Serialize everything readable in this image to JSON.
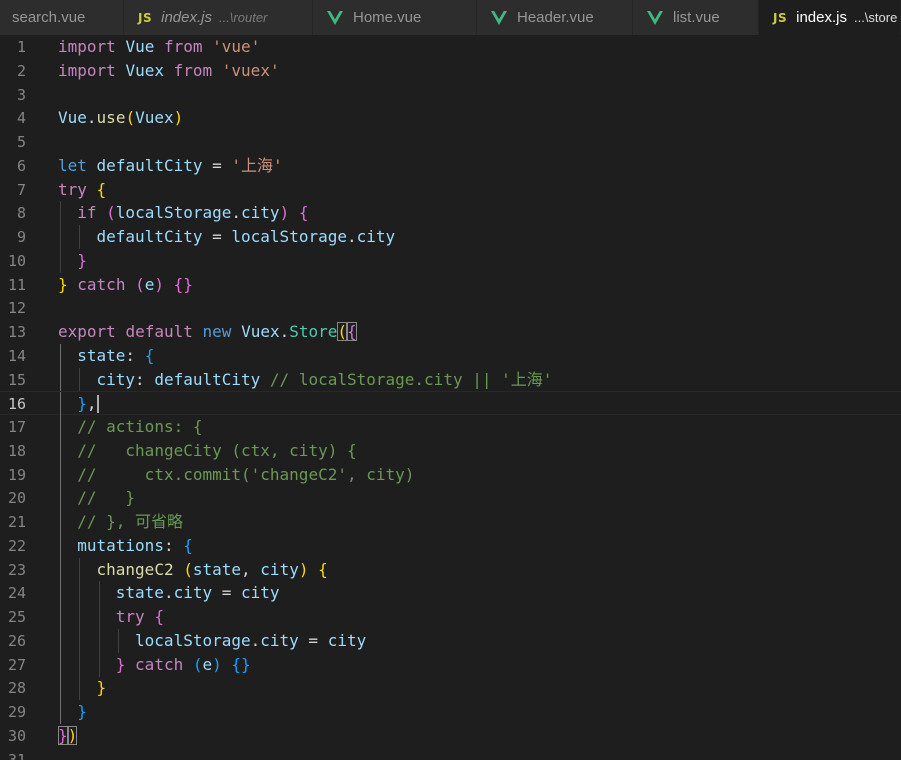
{
  "tabs": [
    {
      "icon": "",
      "name": "search.vue",
      "desc": "",
      "italic": false,
      "active": false
    },
    {
      "icon": "js",
      "name": "index.js",
      "desc": "...\\router",
      "italic": true,
      "active": false
    },
    {
      "icon": "vue",
      "name": "Home.vue",
      "desc": "",
      "italic": false,
      "active": false
    },
    {
      "icon": "vue",
      "name": "Header.vue",
      "desc": "",
      "italic": false,
      "active": false
    },
    {
      "icon": "vue",
      "name": "list.vue",
      "desc": "",
      "italic": false,
      "active": false
    },
    {
      "icon": "js",
      "name": "index.js",
      "desc": "...\\store",
      "italic": false,
      "active": true
    }
  ],
  "js_icon_label": "JS",
  "colors": {
    "vue_icon": "#41b883",
    "js_icon": "#cbcb41",
    "editor_bg": "#1e1e1e"
  },
  "editor": {
    "current_line": 16,
    "lines": [
      {
        "n": "1",
        "indent": 0,
        "tokens": [
          [
            "kw",
            "import"
          ],
          [
            "p",
            " "
          ],
          [
            "id",
            "Vue"
          ],
          [
            "p",
            " "
          ],
          [
            "kw",
            "from"
          ],
          [
            "p",
            " "
          ],
          [
            "str",
            "'vue'"
          ]
        ]
      },
      {
        "n": "2",
        "indent": 0,
        "tokens": [
          [
            "kw",
            "import"
          ],
          [
            "p",
            " "
          ],
          [
            "id",
            "Vuex"
          ],
          [
            "p",
            " "
          ],
          [
            "kw",
            "from"
          ],
          [
            "p",
            " "
          ],
          [
            "str",
            "'vuex'"
          ]
        ]
      },
      {
        "n": "3",
        "indent": 0,
        "tokens": []
      },
      {
        "n": "4",
        "indent": 0,
        "tokens": [
          [
            "id",
            "Vue"
          ],
          [
            "p",
            "."
          ],
          [
            "fn",
            "use"
          ],
          [
            "b1",
            "("
          ],
          [
            "id",
            "Vuex"
          ],
          [
            "b1",
            ")"
          ]
        ]
      },
      {
        "n": "5",
        "indent": 0,
        "tokens": []
      },
      {
        "n": "6",
        "indent": 0,
        "tokens": [
          [
            "kwb",
            "let"
          ],
          [
            "p",
            " "
          ],
          [
            "id",
            "defaultCity"
          ],
          [
            "p",
            " = "
          ],
          [
            "str",
            "'上海'"
          ]
        ]
      },
      {
        "n": "7",
        "indent": 0,
        "tokens": [
          [
            "kw",
            "try"
          ],
          [
            "p",
            " "
          ],
          [
            "b1",
            "{"
          ]
        ]
      },
      {
        "n": "8",
        "indent": 1,
        "tokens": [
          [
            "kw",
            "if"
          ],
          [
            "p",
            " "
          ],
          [
            "b2",
            "("
          ],
          [
            "id",
            "localStorage"
          ],
          [
            "p",
            "."
          ],
          [
            "id",
            "city"
          ],
          [
            "b2",
            ")"
          ],
          [
            "p",
            " "
          ],
          [
            "b2",
            "{"
          ]
        ]
      },
      {
        "n": "9",
        "indent": 2,
        "tokens": [
          [
            "id",
            "defaultCity"
          ],
          [
            "p",
            " = "
          ],
          [
            "id",
            "localStorage"
          ],
          [
            "p",
            "."
          ],
          [
            "id",
            "city"
          ]
        ]
      },
      {
        "n": "10",
        "indent": 1,
        "tokens": [
          [
            "b2",
            "}"
          ]
        ]
      },
      {
        "n": "11",
        "indent": 0,
        "tokens": [
          [
            "b1",
            "}"
          ],
          [
            "p",
            " "
          ],
          [
            "kw",
            "catch"
          ],
          [
            "p",
            " "
          ],
          [
            "b2",
            "("
          ],
          [
            "id",
            "e"
          ],
          [
            "b2",
            ")"
          ],
          [
            "p",
            " "
          ],
          [
            "b2",
            "{}"
          ]
        ]
      },
      {
        "n": "12",
        "indent": 0,
        "tokens": []
      },
      {
        "n": "13",
        "indent": 0,
        "tokens": [
          [
            "kw",
            "export"
          ],
          [
            "p",
            " "
          ],
          [
            "kw",
            "default"
          ],
          [
            "p",
            " "
          ],
          [
            "kwb",
            "new"
          ],
          [
            "p",
            " "
          ],
          [
            "id",
            "Vuex"
          ],
          [
            "p",
            "."
          ],
          [
            "cls",
            "Store"
          ],
          [
            "b1",
            "("
          ],
          [
            "b2",
            "{"
          ]
        ]
      },
      {
        "n": "14",
        "indent": 1,
        "tokens": [
          [
            "id",
            "state"
          ],
          [
            "p",
            ": "
          ],
          [
            "b3",
            "{"
          ]
        ]
      },
      {
        "n": "15",
        "indent": 2,
        "tokens": [
          [
            "id",
            "city"
          ],
          [
            "p",
            ": "
          ],
          [
            "id",
            "defaultCity"
          ],
          [
            "p",
            " "
          ],
          [
            "com",
            "// localStorage.city || '上海'"
          ]
        ]
      },
      {
        "n": "16",
        "indent": 1,
        "tokens": [
          [
            "b3",
            "}"
          ],
          [
            "p",
            ","
          ]
        ]
      },
      {
        "n": "17",
        "indent": 1,
        "tokens": [
          [
            "com",
            "// actions: {"
          ]
        ]
      },
      {
        "n": "18",
        "indent": 1,
        "tokens": [
          [
            "com",
            "//   changeCity (ctx, city) {"
          ]
        ]
      },
      {
        "n": "19",
        "indent": 1,
        "tokens": [
          [
            "com",
            "//     ctx.commit('changeC2', city)"
          ]
        ]
      },
      {
        "n": "20",
        "indent": 1,
        "tokens": [
          [
            "com",
            "//   }"
          ]
        ]
      },
      {
        "n": "21",
        "indent": 1,
        "tokens": [
          [
            "com",
            "// }, 可省略"
          ]
        ]
      },
      {
        "n": "22",
        "indent": 1,
        "tokens": [
          [
            "id",
            "mutations"
          ],
          [
            "p",
            ": "
          ],
          [
            "b3",
            "{"
          ]
        ]
      },
      {
        "n": "23",
        "indent": 2,
        "tokens": [
          [
            "fn",
            "changeC2"
          ],
          [
            "p",
            " "
          ],
          [
            "b1",
            "("
          ],
          [
            "id",
            "state"
          ],
          [
            "p",
            ", "
          ],
          [
            "id",
            "city"
          ],
          [
            "b1",
            ")"
          ],
          [
            "p",
            " "
          ],
          [
            "b1",
            "{"
          ]
        ]
      },
      {
        "n": "24",
        "indent": 3,
        "tokens": [
          [
            "id",
            "state"
          ],
          [
            "p",
            "."
          ],
          [
            "id",
            "city"
          ],
          [
            "p",
            " = "
          ],
          [
            "id",
            "city"
          ]
        ]
      },
      {
        "n": "25",
        "indent": 3,
        "tokens": [
          [
            "kw",
            "try"
          ],
          [
            "p",
            " "
          ],
          [
            "b2",
            "{"
          ]
        ]
      },
      {
        "n": "26",
        "indent": 4,
        "tokens": [
          [
            "id",
            "localStorage"
          ],
          [
            "p",
            "."
          ],
          [
            "id",
            "city"
          ],
          [
            "p",
            " = "
          ],
          [
            "id",
            "city"
          ]
        ]
      },
      {
        "n": "27",
        "indent": 3,
        "tokens": [
          [
            "b2",
            "}"
          ],
          [
            "p",
            " "
          ],
          [
            "kw",
            "catch"
          ],
          [
            "p",
            " "
          ],
          [
            "b3",
            "("
          ],
          [
            "id",
            "e"
          ],
          [
            "b3",
            ")"
          ],
          [
            "p",
            " "
          ],
          [
            "b3",
            "{}"
          ]
        ]
      },
      {
        "n": "28",
        "indent": 2,
        "tokens": [
          [
            "b1",
            "}"
          ]
        ]
      },
      {
        "n": "29",
        "indent": 1,
        "tokens": [
          [
            "b3",
            "}"
          ]
        ]
      },
      {
        "n": "30",
        "indent": 0,
        "tokens": [
          [
            "b2",
            "}"
          ],
          [
            "b1",
            ")"
          ]
        ]
      },
      {
        "n": "31",
        "indent": 0,
        "tokens": []
      }
    ]
  }
}
